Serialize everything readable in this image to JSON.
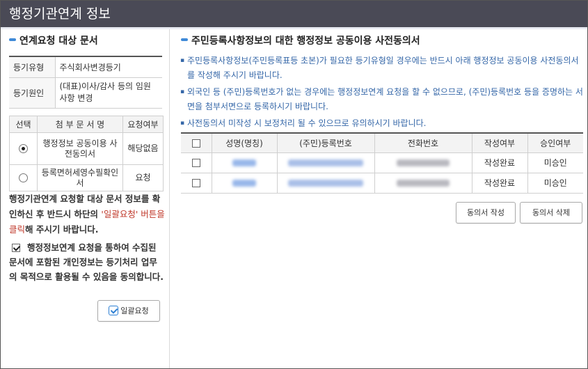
{
  "window": {
    "title": "행정기관연계 정보"
  },
  "left": {
    "section_title": "연계요청 대상 문서",
    "info": [
      {
        "label": "등기유형",
        "value": "주식회사변경등기"
      },
      {
        "label": "등기원인",
        "value": "(대표)이사/감사 등의 임원사항 변경"
      }
    ],
    "attachments": {
      "headers": [
        "선택",
        "첨 부 문 서 명",
        "요청여부"
      ],
      "rows": [
        {
          "selected": true,
          "name": "행정정보 공동이용 사전동의서",
          "status": "해당없음"
        },
        {
          "selected": false,
          "name": "등록면허세영수필확인서",
          "status": "요청"
        }
      ]
    },
    "notice": {
      "prefix": "행정기관연계 요청할 대상 문서 정보를 확인하신 후 반드시 하단의 ",
      "highlight": "'일괄요청' 버튼을 클릭",
      "suffix": "해 주시기 바랍니다."
    },
    "consent": {
      "checked": true,
      "text": "행정정보연계 요청을 통하여 수집된 문서에 포함된 개인정보는 등기처리 업무의 목적으로 활용될 수 있음을 동의합니다."
    },
    "batch_button": "일괄요청"
  },
  "right": {
    "section_title": "주민등록사항정보의 대한 행정정보 공동이용 사전동의서",
    "bullets": [
      "주민등록사항정보(주민등록표등 초본)가 필요한 등기유형일 경우에는 반드시 아래 행정정보 공동이용 사전동의서를 작성해 주시기 바랍니다.",
      "외국인 등 (주민)등록번호가 없는 경우에는 행정정보연계 요청을 할 수 없으므로, (주민)등록번호 등을 증명하는 서면을 첨부서면으로 등록하시기 바랍니다.",
      "사전동의서 미작성 시 보정처리 될 수 있으므로 유의하시기 바랍니다."
    ],
    "table": {
      "headers": [
        "성명(명칭)",
        "(주민)등록번호",
        "전화번호",
        "작성여부",
        "승인여부"
      ],
      "rows": [
        {
          "written": "작성완료",
          "approved": "미승인"
        },
        {
          "written": "작성완료",
          "approved": "미승인"
        }
      ]
    },
    "write_button": "동의서 작성",
    "delete_button": "동의서 삭제"
  },
  "colors": {
    "title_bar": "#4a4a56",
    "accent": "#3f8ad8",
    "notice_text": "#3567a8",
    "highlight": "#c0392b"
  }
}
